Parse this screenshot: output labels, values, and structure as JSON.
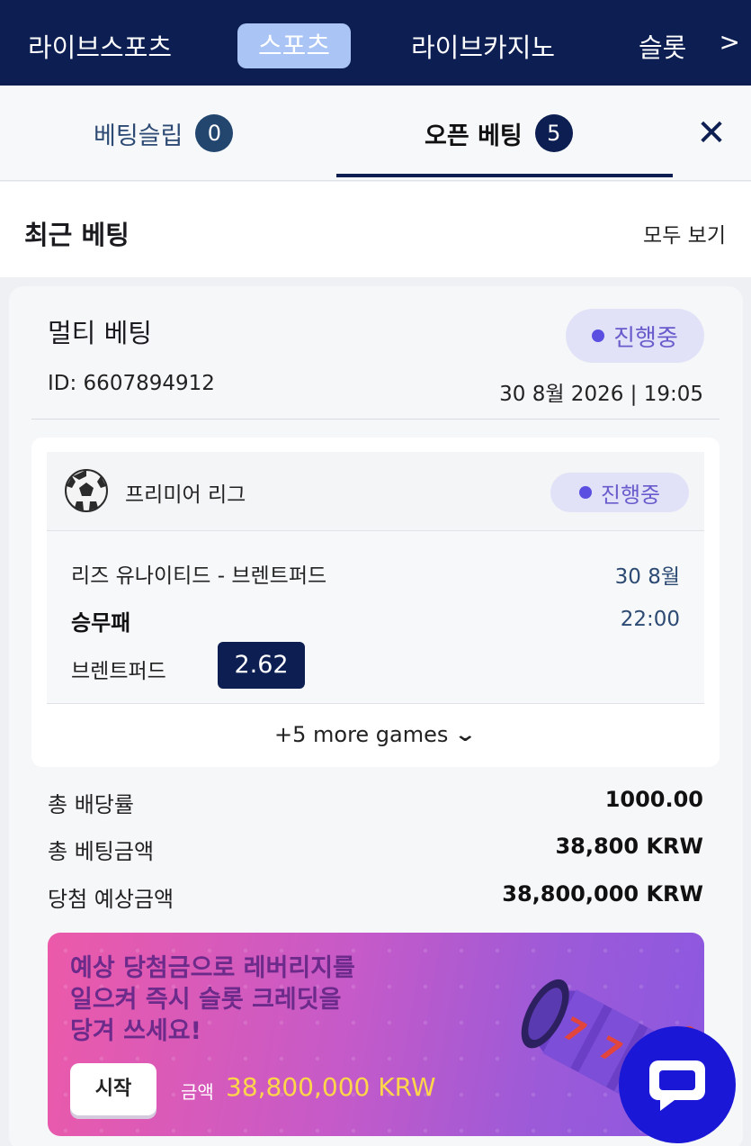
{
  "topnav": {
    "items": [
      "라이브스포츠",
      "스포츠",
      "라이브카지노",
      "슬롯"
    ],
    "active_index": 1,
    "more": ">"
  },
  "tabs": {
    "slip_label": "베팅슬립",
    "slip_count": "0",
    "open_label": "오픈 베팅",
    "open_count": "5",
    "close": "✕"
  },
  "recent": {
    "title": "최근 베팅",
    "view_all": "모두 보기"
  },
  "bet": {
    "type": "멀티 베팅",
    "status": "진행중",
    "id": "ID: 6607894912",
    "datetime": "30 8월 2026 | 19:05",
    "league": "프리미어 리그",
    "league_status": "진행중",
    "match": "리즈 유나이티드 - 브렌트퍼드",
    "match_date": "30 8월",
    "market": "승무패",
    "match_time": "22:00",
    "pick": "브렌트퍼드",
    "odds": "2.62",
    "more_games": "+5 more games",
    "summary": [
      {
        "label": "총 배당률",
        "value": "1000.00"
      },
      {
        "label": "총 베팅금액",
        "value": "38,800 KRW"
      },
      {
        "label": "당첨 예상금액",
        "value": "38,800,000 KRW"
      }
    ]
  },
  "promo": {
    "text": "예상 당첨금으로 레버리지를 일으켜 즉시 슬롯 크레딧을 당겨 쓰세요!",
    "start_label": "시작",
    "amount_label": "금액",
    "amount_value": "38,800,000 KRW"
  },
  "colors": {
    "nav_bg": "#0d1f52",
    "accent": "#0d1f52",
    "status_bg": "#e1e2f8",
    "status_text": "#6a5bcc",
    "promo_amount": "#ffd54a",
    "chat": "#1a18d6"
  },
  "icons": [
    "soccer-ball-icon",
    "chevron-down-icon",
    "close-icon",
    "chat-bubble-icon",
    "slot-reel-icon"
  ]
}
